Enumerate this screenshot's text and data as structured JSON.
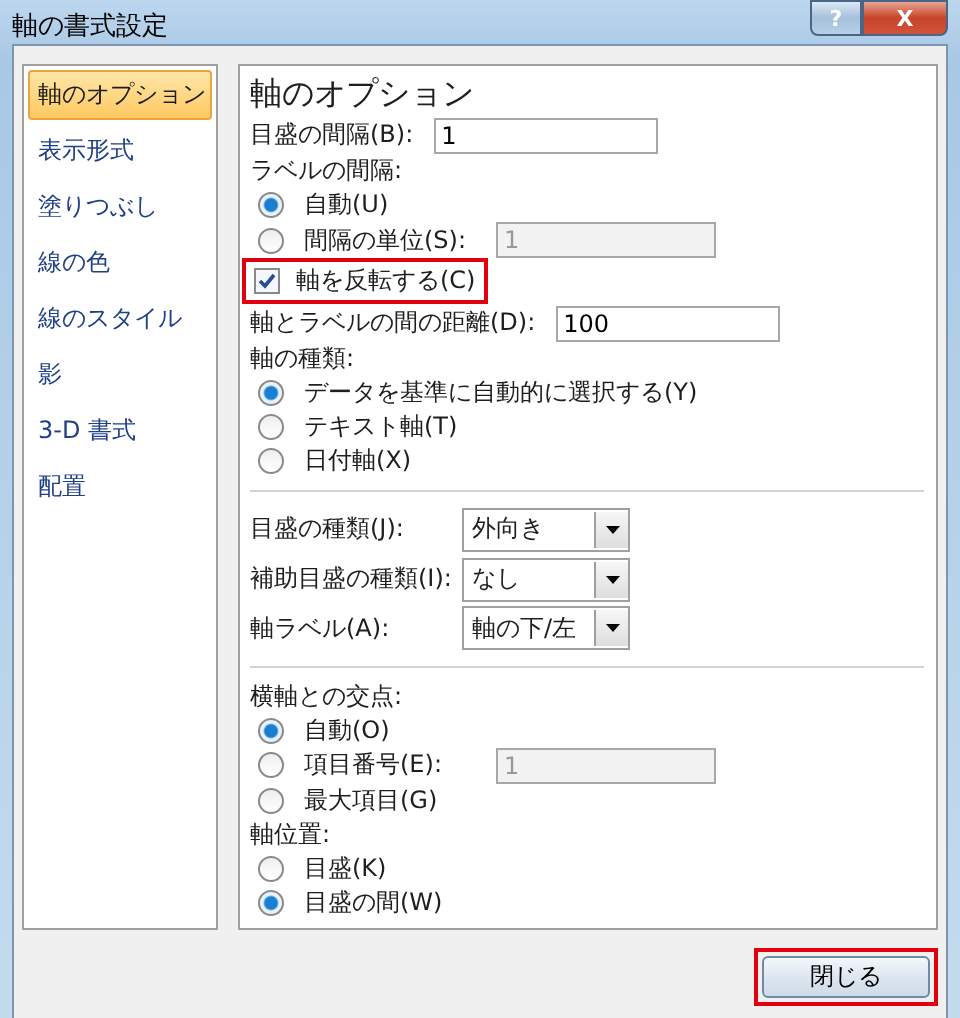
{
  "window": {
    "title": "軸の書式設定",
    "help_button": "?",
    "close_button": "X"
  },
  "sidebar": {
    "items": [
      {
        "label": "軸のオプション",
        "selected": true
      },
      {
        "label": "表示形式",
        "selected": false
      },
      {
        "label": "塗りつぶし",
        "selected": false
      },
      {
        "label": "線の色",
        "selected": false
      },
      {
        "label": "線のスタイル",
        "selected": false
      },
      {
        "label": "影",
        "selected": false
      },
      {
        "label": "3-D 書式",
        "selected": false
      },
      {
        "label": "配置",
        "selected": false
      }
    ]
  },
  "panel": {
    "items": [
      {
        "kind": "heading",
        "label": "軸のオプション"
      },
      {
        "kind": "field",
        "label": "目盛の間隔(B):",
        "value": "1",
        "disabled": false
      },
      {
        "kind": "group",
        "label": "ラベルの間隔:"
      },
      {
        "kind": "radio",
        "label": "自動(U)",
        "selected": true
      },
      {
        "kind": "radio",
        "label": "間隔の単位(S):",
        "selected": false,
        "value": "1",
        "disabled": true
      },
      {
        "kind": "checkbox",
        "label": "軸を反転する(C)",
        "checked": true,
        "highlighted": true
      },
      {
        "kind": "field",
        "label": "軸とラベルの間の距離(D):",
        "value": "100",
        "disabled": false
      },
      {
        "kind": "group",
        "label": "軸の種類:"
      },
      {
        "kind": "radio",
        "label": "データを基準に自動的に選択する(Y)",
        "selected": true
      },
      {
        "kind": "radio",
        "label": "テキスト軸(T)",
        "selected": false
      },
      {
        "kind": "radio",
        "label": "日付軸(X)",
        "selected": false
      },
      {
        "kind": "divider"
      },
      {
        "kind": "dropdown",
        "label": "目盛の種類(J):",
        "value": "外向き"
      },
      {
        "kind": "dropdown",
        "label": "補助目盛の種類(I):",
        "value": "なし"
      },
      {
        "kind": "dropdown",
        "label": "軸ラベル(A):",
        "value": "軸の下/左"
      },
      {
        "kind": "divider"
      },
      {
        "kind": "group",
        "label": "横軸との交点:"
      },
      {
        "kind": "radio",
        "label": "自動(O)",
        "selected": true
      },
      {
        "kind": "radio",
        "label": "項目番号(E):",
        "selected": false,
        "value": "1",
        "disabled": true
      },
      {
        "kind": "radio",
        "label": "最大項目(G)",
        "selected": false
      },
      {
        "kind": "group",
        "label": "軸位置:"
      },
      {
        "kind": "radio",
        "label": "目盛(K)",
        "selected": false
      },
      {
        "kind": "radio",
        "label": "目盛の間(W)",
        "selected": true
      }
    ]
  },
  "footer": {
    "close_button": {
      "label": "閉じる",
      "highlighted": true
    }
  }
}
